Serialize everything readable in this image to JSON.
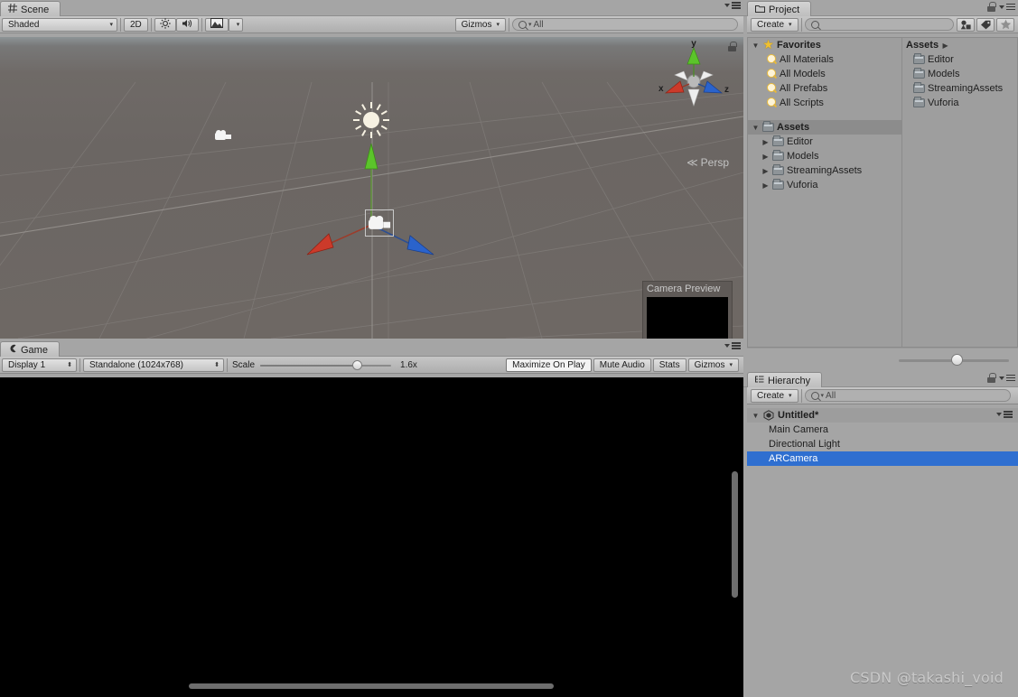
{
  "scene": {
    "tab_label": "Scene",
    "tab_icon": "grid-icon",
    "shading_mode": "Shaded",
    "twod_button": "2D",
    "lighting_icon": "sun-icon",
    "audio_icon": "speaker-icon",
    "effects_icon": "image-icon",
    "gizmos_button": "Gizmos",
    "search_placeholder": "All",
    "search_value": "",
    "persp_label": "Persp",
    "axis_x": "x",
    "axis_y": "y",
    "axis_z": "z",
    "camera_preview_title": "Camera Preview",
    "lock_icon": "lock-icon",
    "menu_icon": "panel-menu-icon"
  },
  "game": {
    "tab_label": "Game",
    "tab_icon": "gamepad-icon",
    "display": "Display 1",
    "resolution": "Standalone (1024x768)",
    "scale_label": "Scale",
    "scale_value": "1.6x",
    "maximize_on_play": "Maximize On Play",
    "mute_audio": "Mute Audio",
    "stats": "Stats",
    "gizmos": "Gizmos",
    "menu_icon": "panel-menu-icon"
  },
  "project": {
    "tab_label": "Project",
    "tab_icon": "folder-icon",
    "create_button": "Create",
    "search_placeholder": "",
    "search_value": "",
    "filter_type_icon": "filter-by-type-icon",
    "filter_label_icon": "filter-by-label-icon",
    "favorite_icon": "star-icon",
    "lock_icon": "lock-icon",
    "menu_icon": "panel-menu-icon",
    "favorites": {
      "label": "Favorites",
      "icon": "star-icon",
      "items": [
        {
          "label": "All Materials",
          "icon": "search-icon"
        },
        {
          "label": "All Models",
          "icon": "search-icon"
        },
        {
          "label": "All Prefabs",
          "icon": "search-icon"
        },
        {
          "label": "All Scripts",
          "icon": "search-icon"
        }
      ]
    },
    "assets_tree": {
      "label": "Assets",
      "icon": "folder-icon",
      "items": [
        {
          "label": "Editor",
          "icon": "folder-icon"
        },
        {
          "label": "Models",
          "icon": "folder-icon"
        },
        {
          "label": "StreamingAssets",
          "icon": "folder-icon"
        },
        {
          "label": "Vuforia",
          "icon": "folder-icon"
        }
      ]
    },
    "breadcrumb": "Assets",
    "content_items": [
      {
        "label": "Editor",
        "icon": "folder-icon"
      },
      {
        "label": "Models",
        "icon": "folder-icon"
      },
      {
        "label": "StreamingAssets",
        "icon": "folder-icon"
      },
      {
        "label": "Vuforia",
        "icon": "folder-icon"
      }
    ]
  },
  "hierarchy": {
    "tab_label": "Hierarchy",
    "tab_icon": "hierarchy-icon",
    "create_button": "Create",
    "search_placeholder": "All",
    "search_value": "",
    "scene_name": "Untitled*",
    "scene_icon": "unity-logo-icon",
    "lock_icon": "lock-icon",
    "menu_icon": "panel-menu-icon",
    "objects": [
      {
        "label": "Main Camera",
        "selected": false
      },
      {
        "label": "Directional Light",
        "selected": false
      },
      {
        "label": "ARCamera",
        "selected": true
      }
    ]
  },
  "watermark": "CSDN @takashi_void",
  "colors": {
    "selection_blue": "#2f6fd0",
    "axis_x_red": "#cc3a2a",
    "axis_y_green": "#5bc42a",
    "axis_z_blue": "#2a63cc",
    "panel_gray": "#a5a5a5",
    "game_black": "#000000"
  }
}
